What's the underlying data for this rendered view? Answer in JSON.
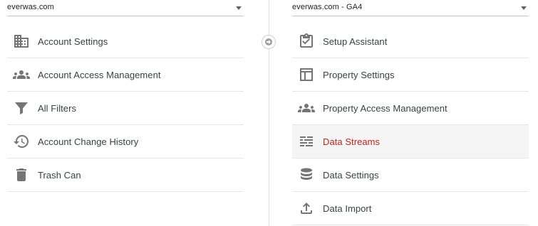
{
  "account": {
    "selector_value": "everwas.com",
    "items": [
      {
        "label": "Account Settings",
        "icon": "building-icon"
      },
      {
        "label": "Account Access Management",
        "icon": "people-icon"
      },
      {
        "label": "All Filters",
        "icon": "filter-icon"
      },
      {
        "label": "Account Change History",
        "icon": "history-icon"
      },
      {
        "label": "Trash Can",
        "icon": "trash-icon"
      }
    ]
  },
  "property": {
    "selector_value": "everwas.com - GA4",
    "items": [
      {
        "label": "Setup Assistant",
        "icon": "clipboard-check-icon"
      },
      {
        "label": "Property Settings",
        "icon": "layout-icon"
      },
      {
        "label": "Property Access Management",
        "icon": "people-icon"
      },
      {
        "label": "Data Streams",
        "icon": "streams-icon",
        "active": true
      },
      {
        "label": "Data Settings",
        "icon": "database-icon"
      },
      {
        "label": "Data Import",
        "icon": "upload-icon"
      }
    ]
  },
  "colors": {
    "active_text": "#c5221f",
    "icon": "#757575",
    "divider": "#dadce0"
  }
}
